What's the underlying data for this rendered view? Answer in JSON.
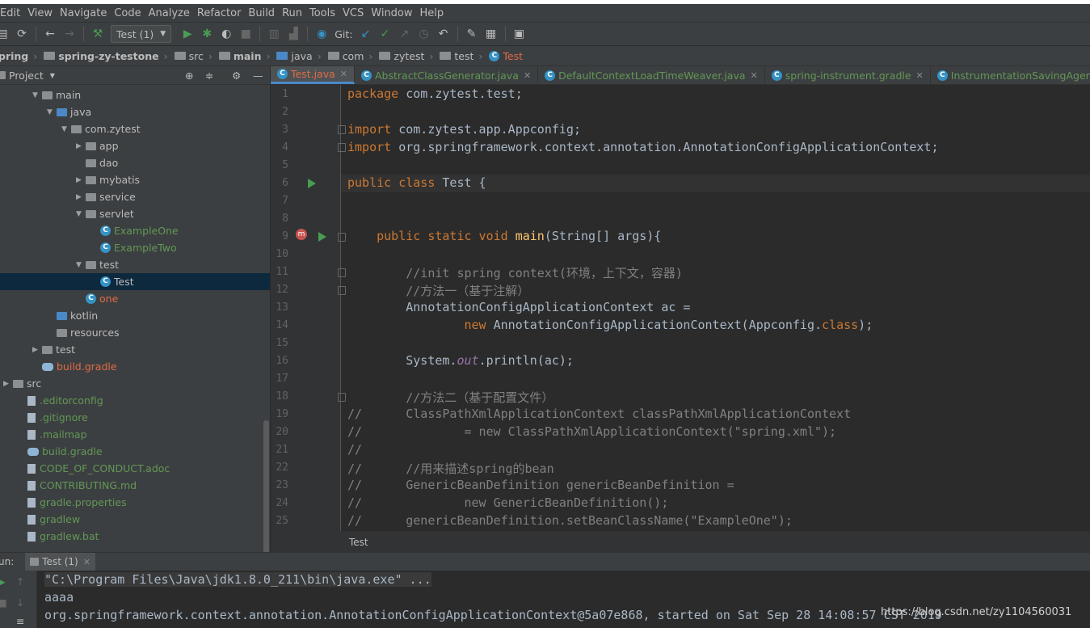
{
  "menu": [
    "Edit",
    "View",
    "Navigate",
    "Code",
    "Analyze",
    "Refactor",
    "Build",
    "Run",
    "Tools",
    "VCS",
    "Window",
    "Help"
  ],
  "toolbar": {
    "run_config": "Test (1)",
    "git_label": "Git:"
  },
  "breadcrumb": [
    "pring",
    "spring-zy-testone",
    "src",
    "main",
    "java",
    "com",
    "zytest",
    "test",
    "Test"
  ],
  "project": {
    "title": "Project"
  },
  "tree": [
    {
      "label": "main",
      "indent": 40,
      "arrow": "▼",
      "icon": "folder",
      "color": "#bbbbbb"
    },
    {
      "label": "java",
      "indent": 58,
      "arrow": "▼",
      "icon": "folder-blue",
      "color": "#bbbbbb"
    },
    {
      "label": "com.zytest",
      "indent": 76,
      "arrow": "▼",
      "icon": "folder",
      "color": "#bbbbbb"
    },
    {
      "label": "app",
      "indent": 94,
      "arrow": "▶",
      "icon": "folder",
      "color": "#bbbbbb"
    },
    {
      "label": "dao",
      "indent": 94,
      "arrow": "",
      "icon": "folder",
      "color": "#bbbbbb"
    },
    {
      "label": "mybatis",
      "indent": 94,
      "arrow": "▶",
      "icon": "folder",
      "color": "#bbbbbb"
    },
    {
      "label": "service",
      "indent": 94,
      "arrow": "▶",
      "icon": "folder",
      "color": "#bbbbbb"
    },
    {
      "label": "servlet",
      "indent": 94,
      "arrow": "▼",
      "icon": "folder",
      "color": "#bbbbbb"
    },
    {
      "label": "ExampleOne",
      "indent": 112,
      "arrow": "",
      "icon": "class",
      "color": "#629755"
    },
    {
      "label": "ExampleTwo",
      "indent": 112,
      "arrow": "",
      "icon": "class",
      "color": "#629755"
    },
    {
      "label": "test",
      "indent": 94,
      "arrow": "▼",
      "icon": "folder",
      "color": "#bbbbbb"
    },
    {
      "label": "Test",
      "indent": 112,
      "arrow": "",
      "icon": "class",
      "color": "#bbbbbb"
    },
    {
      "label": "one",
      "indent": 94,
      "arrow": "",
      "icon": "class",
      "color": "#e06b45"
    },
    {
      "label": "kotlin",
      "indent": 58,
      "arrow": "",
      "icon": "folder-blue",
      "color": "#bbbbbb"
    },
    {
      "label": "resources",
      "indent": 58,
      "arrow": "",
      "icon": "folder",
      "color": "#bbbbbb"
    },
    {
      "label": "test",
      "indent": 40,
      "arrow": "▶",
      "icon": "folder",
      "color": "#bbbbbb"
    },
    {
      "label": "build.gradle",
      "indent": 40,
      "arrow": "",
      "icon": "gradle",
      "color": "#e06b45"
    },
    {
      "label": "src",
      "indent": 4,
      "arrow": "▶",
      "icon": "folder",
      "color": "#bbbbbb"
    },
    {
      "label": ".editorconfig",
      "indent": 22,
      "arrow": "",
      "icon": "file",
      "color": "#629755"
    },
    {
      "label": ".gitignore",
      "indent": 22,
      "arrow": "",
      "icon": "file",
      "color": "#629755"
    },
    {
      "label": ".mailmap",
      "indent": 22,
      "arrow": "",
      "icon": "file",
      "color": "#629755"
    },
    {
      "label": "build.gradle",
      "indent": 22,
      "arrow": "",
      "icon": "gradle",
      "color": "#629755"
    },
    {
      "label": "CODE_OF_CONDUCT.adoc",
      "indent": 22,
      "arrow": "",
      "icon": "file",
      "color": "#629755"
    },
    {
      "label": "CONTRIBUTING.md",
      "indent": 22,
      "arrow": "",
      "icon": "file",
      "color": "#629755"
    },
    {
      "label": "gradle.properties",
      "indent": 22,
      "arrow": "",
      "icon": "file",
      "color": "#629755"
    },
    {
      "label": "gradlew",
      "indent": 22,
      "arrow": "",
      "icon": "file",
      "color": "#629755"
    },
    {
      "label": "gradlew.bat",
      "indent": 22,
      "arrow": "",
      "icon": "file",
      "color": "#629755"
    }
  ],
  "tabs": [
    {
      "label": "Test.java",
      "color": "#e06b45",
      "active": true
    },
    {
      "label": "AbstractClassGenerator.java",
      "color": "#629755",
      "active": false
    },
    {
      "label": "DefaultContextLoadTimeWeaver.java",
      "color": "#629755",
      "active": false
    },
    {
      "label": "spring-instrument.gradle",
      "color": "#629755",
      "active": false
    },
    {
      "label": "InstrumentationSavingAgent.java",
      "color": "#629755",
      "active": false
    }
  ],
  "code": [
    "<span class=\"kw\">package</span> com.zytest.test;",
    "",
    "<span class=\"kw\">import</span> com.zytest.app.Appconfig;",
    "<span class=\"kw\">import</span> org.springframework.context.annotation.AnnotationConfigApplicationContext;",
    "",
    "<span class=\"kw\">public class</span> Test {",
    "",
    "",
    "    <span class=\"kw\">public static void</span> <span class=\"fn\">main</span>(String[] args){",
    "",
    "        <span class=\"cm\">//init spring context(环境，上下文，容器)</span>",
    "        <span class=\"cm\">//方法一（基于注解）</span>",
    "        AnnotationConfigApplicationContext ac =",
    "                <span class=\"kw\">new</span> AnnotationConfigApplicationContext(Appconfig.<span class=\"kw\">class</span>);",
    "",
    "        System.<span class=\"it\">out</span>.println(ac);",
    "",
    "        <span class=\"cm\">//方法二（基于配置文件）</span>",
    "<span class=\"cm\">//      ClassPathXmlApplicationContext classPathXmlApplicationContext</span>",
    "<span class=\"cm\">//              = new ClassPathXmlApplicationContext(\"spring.xml\");</span>",
    "<span class=\"cm\">//</span>",
    "<span class=\"cm\">//      //用来描述spring的bean</span>",
    "<span class=\"cm\">//      GenericBeanDefinition genericBeanDefinition =</span>",
    "<span class=\"cm\">//              new GenericBeanDefinition();</span>",
    "<span class=\"cm\">//      genericBeanDefinition.setBeanClassName(\"ExampleOne\");</span>"
  ],
  "editor_breadcrumb": "Test",
  "run": {
    "label": "un:",
    "tab": "Test (1)"
  },
  "console": [
    "\"C:\\Program Files\\Java\\jdk1.8.0_211\\bin\\java.exe\" ...",
    "aaaa",
    "org.springframework.context.annotation.AnnotationConfigApplicationContext@5a07e868, started on Sat Sep 28 14:08:57 CST 2019"
  ],
  "watermark": "https://blog.csdn.net/zy1104560031"
}
